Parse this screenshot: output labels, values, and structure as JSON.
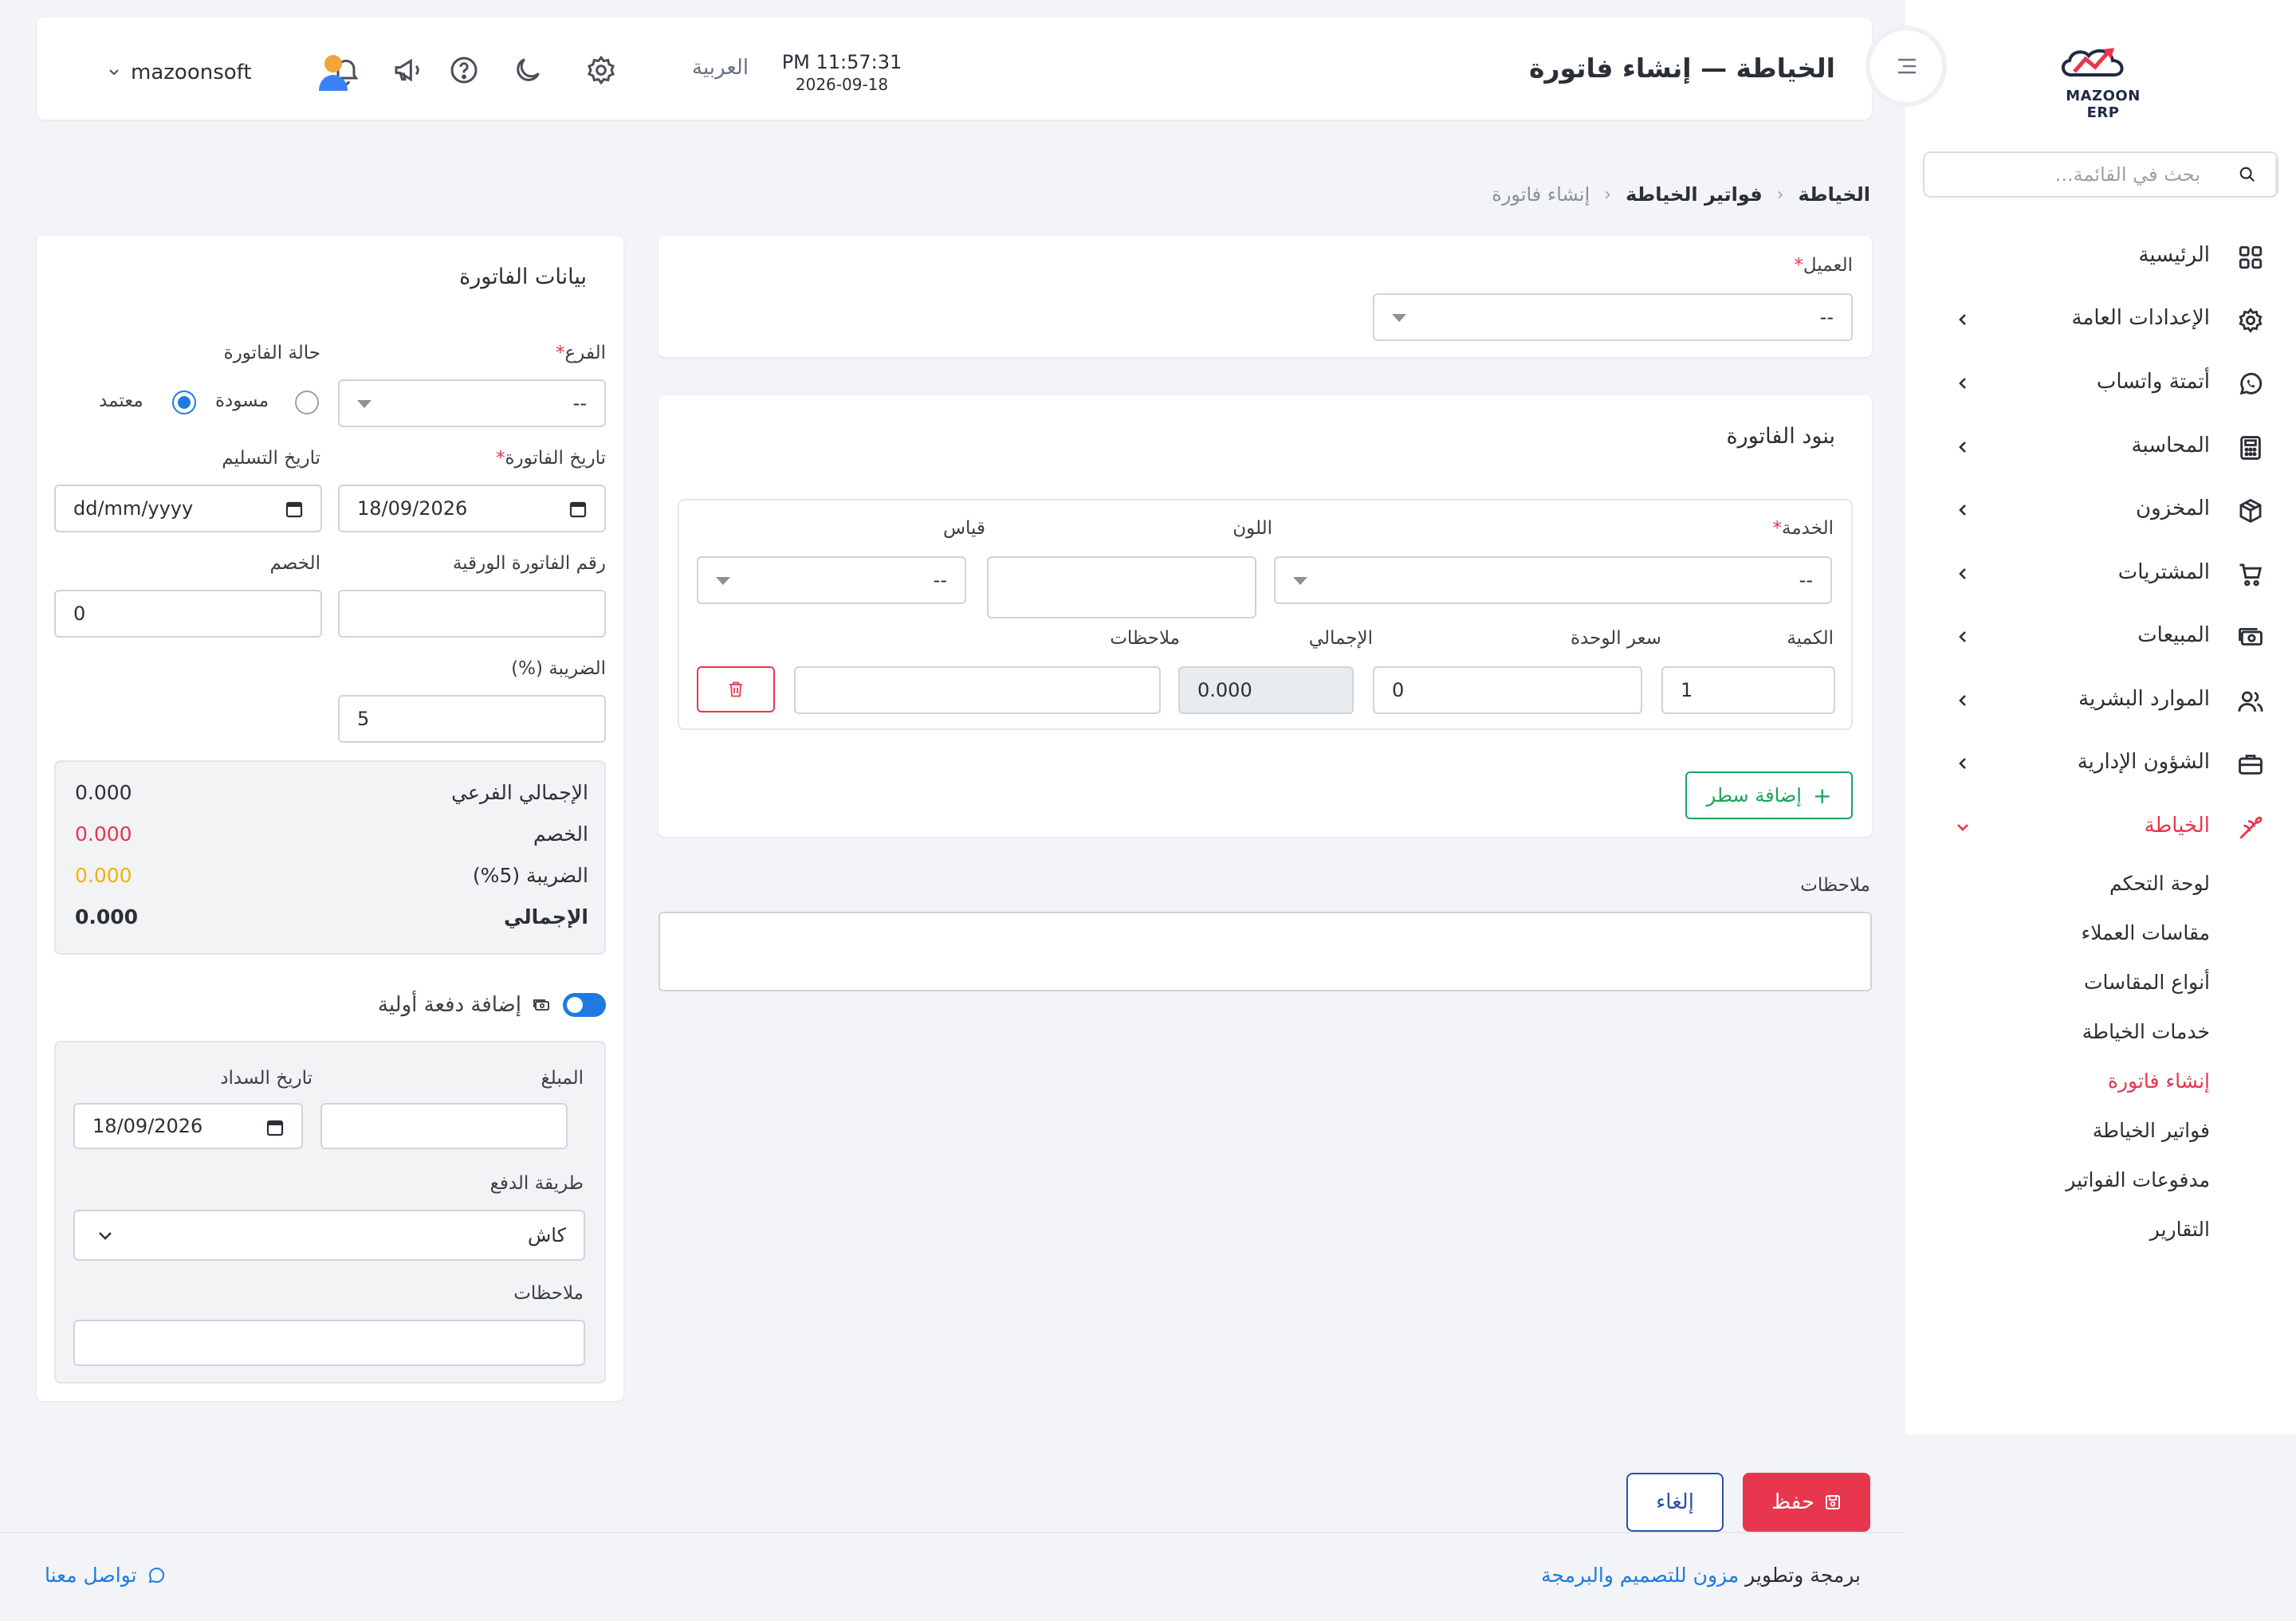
{
  "app": {
    "logo_text": "MAZOON ERP",
    "logo_sub": "ERP ERP"
  },
  "header": {
    "title": "الخياطة — إنشاء فاتورة",
    "time": "PM 11:57:31",
    "date": "2026-09-18",
    "language": "العربية",
    "username": "mazoonsoft"
  },
  "sidebar": {
    "search_placeholder": "بحث في القائمة...",
    "items": [
      {
        "label": "الرئيسية",
        "icon": "grid-icon"
      },
      {
        "label": "الإعدادات العامة",
        "icon": "gear-icon"
      },
      {
        "label": "أتمتة واتساب",
        "icon": "whatsapp-icon"
      },
      {
        "label": "المحاسبة",
        "icon": "calculator-icon"
      },
      {
        "label": "المخزون",
        "icon": "box-icon"
      },
      {
        "label": "المشتريات",
        "icon": "cart-icon"
      },
      {
        "label": "المبيعات",
        "icon": "cash-icon"
      },
      {
        "label": "الموارد البشرية",
        "icon": "users-icon"
      },
      {
        "label": "الشؤون الإدارية",
        "icon": "briefcase-icon"
      },
      {
        "label": "الخياطة",
        "icon": "needle-icon"
      }
    ],
    "sub_items": [
      {
        "label": "لوحة التحكم"
      },
      {
        "label": "مقاسات العملاء"
      },
      {
        "label": "أنواع المقاسات"
      },
      {
        "label": "خدمات الخياطة"
      },
      {
        "label": "إنشاء فاتورة"
      },
      {
        "label": "فواتير الخياطة"
      },
      {
        "label": "مدفوعات الفواتير"
      },
      {
        "label": "التقارير"
      }
    ]
  },
  "breadcrumb": {
    "root": "الخياطة",
    "parent": "فواتير الخياطة",
    "current": "إنشاء فاتورة"
  },
  "customer": {
    "label": "العميل",
    "value": "--"
  },
  "items_card": {
    "title": "بنود الفاتورة",
    "service_label": "الخدمة",
    "service_value": "--",
    "color_label": "اللون",
    "color_value": "",
    "size_label": "قياس",
    "size_value": "--",
    "qty_label": "الكمية",
    "qty_value": "1",
    "price_label": "سعر الوحدة",
    "price_value": "0",
    "total_label": "الإجمالي",
    "total_value": "0.000",
    "notes_label": "ملاحظات",
    "notes_value": "",
    "add_row": "إضافة سطر"
  },
  "notes": {
    "label": "ملاحظات",
    "value": ""
  },
  "invoice": {
    "title": "بيانات الفاتورة",
    "branch_label": "الفرع",
    "branch_value": "--",
    "status_label": "حالة الفاتورة",
    "status_draft": "مسودة",
    "status_approved": "معتمد",
    "invoice_date_label": "تاريخ الفاتورة",
    "invoice_date_value": "18/09/2026",
    "delivery_date_label": "تاريخ التسليم",
    "delivery_date_value": "dd/mm/yyyy",
    "paper_no_label": "رقم الفاتورة الورقية",
    "paper_no_value": "",
    "discount_label": "الخصم",
    "discount_value": "0",
    "tax_label": "الضريبة (%)",
    "tax_value": "5"
  },
  "totals": {
    "subtotal_label": "الإجمالي الفرعي",
    "subtotal_value": "0.000",
    "discount_label": "الخصم",
    "discount_value": "0.000",
    "tax_label": "الضريبة (5%)",
    "tax_value": "0.000",
    "grand_label": "الإجمالي",
    "grand_value": "0.000"
  },
  "payment": {
    "toggle_label": "إضافة دفعة أولية",
    "amount_label": "المبلغ",
    "amount_value": "",
    "pay_date_label": "تاريخ السداد",
    "pay_date_value": "18/09/2026",
    "method_label": "طريقة الدفع",
    "method_value": "كاش",
    "notes_label": "ملاحظات",
    "notes_value": ""
  },
  "actions": {
    "save": "حفظ",
    "cancel": "إلغاء"
  },
  "footer": {
    "prefix": "برمجة وتطوير",
    "company": "مزون للتصميم والبرمجة",
    "contact": "تواصل معنا"
  },
  "colors": {
    "accent": "#e8364e",
    "primary": "#1f7ae0",
    "success": "#1aa35b",
    "warning": "#f0b400"
  }
}
